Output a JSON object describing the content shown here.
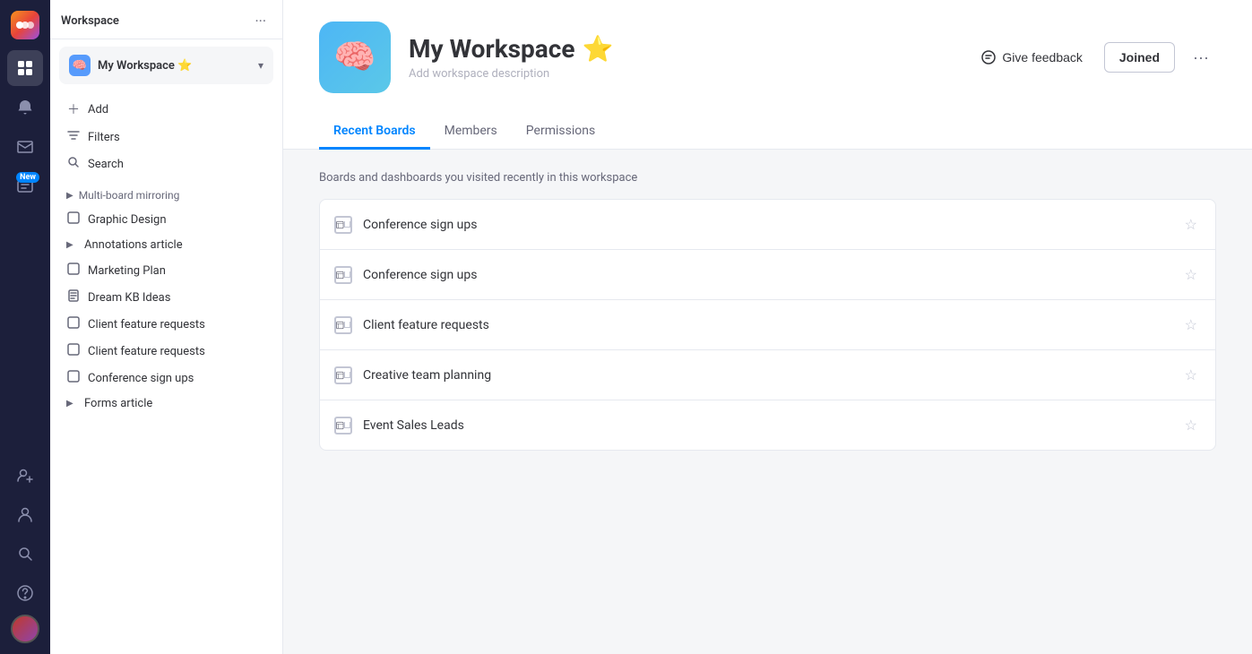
{
  "app": {
    "title": "Monday.com"
  },
  "iconBar": {
    "items": [
      {
        "id": "home",
        "icon": "⊞",
        "active": true
      },
      {
        "id": "notifications",
        "icon": "🔔",
        "badge": null
      },
      {
        "id": "inbox",
        "icon": "📥",
        "badge": null
      },
      {
        "id": "new-item",
        "icon": "📋",
        "badge": "New"
      },
      {
        "id": "templates",
        "icon": "⊕"
      },
      {
        "id": "people",
        "icon": "👤"
      },
      {
        "id": "search",
        "icon": "🔍"
      },
      {
        "id": "help",
        "icon": "?"
      }
    ]
  },
  "sidebar": {
    "header": {
      "title": "Workspace",
      "dots_label": "···"
    },
    "workspace_selector": {
      "icon": "🧠",
      "name": "My Workspace",
      "emoji": "⭐",
      "chevron": "▾"
    },
    "actions": [
      {
        "id": "add",
        "icon": "+",
        "label": "Add"
      },
      {
        "id": "filters",
        "icon": "⧩",
        "label": "Filters"
      },
      {
        "id": "search",
        "icon": "🔍",
        "label": "Search"
      }
    ],
    "nav_items": [
      {
        "id": "multi-board",
        "type": "section",
        "label": "Multi-board mirroring",
        "arrow": "▶"
      },
      {
        "id": "graphic-design",
        "type": "item",
        "icon": "□",
        "label": "Graphic Design"
      },
      {
        "id": "annotations-article",
        "type": "item",
        "icon": "▶",
        "label": "Annotations article",
        "expandable": true
      },
      {
        "id": "marketing-plan",
        "type": "item",
        "icon": "□",
        "label": "Marketing Plan"
      },
      {
        "id": "dream-kb-ideas",
        "type": "item",
        "icon": "📄",
        "label": "Dream KB Ideas"
      },
      {
        "id": "client-feature-requests-1",
        "type": "item",
        "icon": "□",
        "label": "Client feature requests"
      },
      {
        "id": "client-feature-requests-2",
        "type": "item",
        "icon": "□",
        "label": "Client feature requests"
      },
      {
        "id": "conference-sign-ups",
        "type": "item",
        "icon": "□",
        "label": "Conference sign ups"
      },
      {
        "id": "forms-article",
        "type": "item",
        "icon": "▶",
        "label": "Forms article",
        "expandable": true
      }
    ]
  },
  "workspace": {
    "logo_emoji": "🧠",
    "title": "My Workspace",
    "title_emoji": "⭐",
    "description": "Add workspace description",
    "give_feedback_label": "Give feedback",
    "joined_label": "Joined",
    "more_dots": "···"
  },
  "tabs": [
    {
      "id": "recent-boards",
      "label": "Recent Boards",
      "active": true
    },
    {
      "id": "members",
      "label": "Members",
      "active": false
    },
    {
      "id": "permissions",
      "label": "Permissions",
      "active": false
    }
  ],
  "recent_boards": {
    "subtitle": "Boards and dashboards you visited recently in this workspace",
    "items": [
      {
        "id": "board-1",
        "name": "Conference sign ups"
      },
      {
        "id": "board-2",
        "name": "Conference sign ups"
      },
      {
        "id": "board-3",
        "name": "Client feature requests"
      },
      {
        "id": "board-4",
        "name": "Creative team planning"
      },
      {
        "id": "board-5",
        "name": "Event Sales Leads"
      }
    ]
  }
}
